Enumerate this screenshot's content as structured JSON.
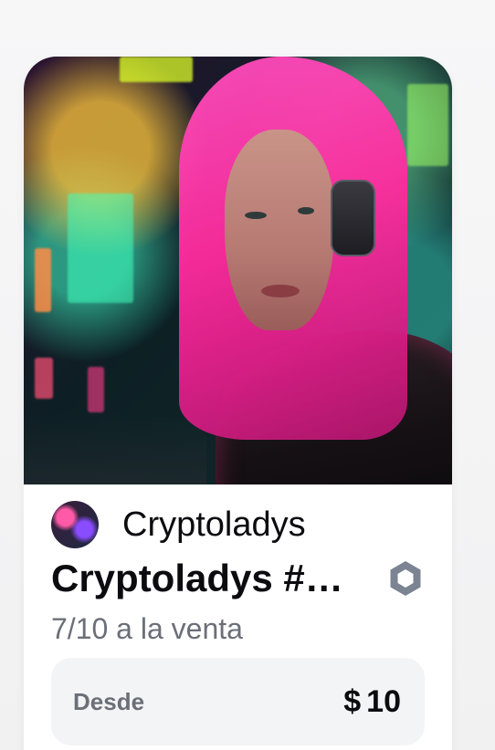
{
  "card": {
    "artwork_alt": "Cryptoladys artwork",
    "creator": {
      "name": "Cryptoladys"
    },
    "title": "Cryptoladys #…",
    "chain_icon": "hexagon-icon",
    "availability": "7/10 a la venta",
    "price": {
      "label": "Desde",
      "currency": "$",
      "amount": "10"
    }
  },
  "colors": {
    "text_primary": "#0c0c10",
    "text_secondary": "#6b6f78",
    "price_box_bg": "#f3f4f6",
    "chain_icon": "#7c8392"
  }
}
